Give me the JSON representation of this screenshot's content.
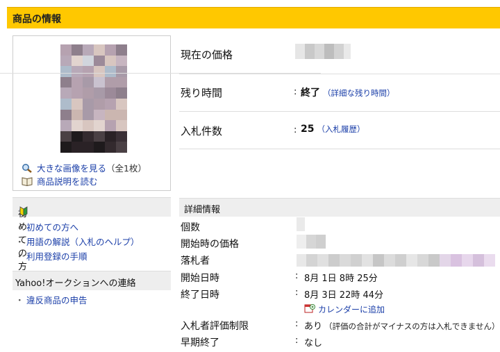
{
  "title": "商品の情報",
  "image_links": {
    "enlarge": "大きな画像を見る",
    "count": "（全1枚）",
    "description": "商品説明を読む"
  },
  "price_rows": {
    "current_price_label": "現在の価格",
    "time_left_label": "残り時間",
    "time_left_value": "終了",
    "time_left_link": "（詳細な残り時間）",
    "bids_label": "入札件数",
    "bids_value": "25",
    "bids_link": "（入札履歴）"
  },
  "sidebar": {
    "beginner_heading": "初めての方",
    "beginner_items": [
      "初めての方へ",
      "用語の解説（入札のヘルプ）",
      "利用登録の手順"
    ],
    "contact_heading": "Yahoo!オークションへの連絡",
    "contact_items": [
      "違反商品の申告"
    ]
  },
  "details": {
    "heading": "詳細情報",
    "quantity_label": "個数",
    "start_price_label": "開始時の価格",
    "winner_label": "落札者",
    "start_date_label": "開始日時",
    "start_date_value": "8月 1日 8時 25分",
    "end_date_label": "終了日時",
    "end_date_value": "8月 3日 22時 44分",
    "calendar_link": "カレンダーに追加",
    "rating_limit_label": "入札者評価制限",
    "rating_limit_value": "あり",
    "rating_limit_note": "（評価の合計がマイナスの方は入札できません）",
    "early_end_label": "早期終了",
    "early_end_value": "なし"
  },
  "colors": {
    "title_bar": "#ffc800",
    "link": "#1a3ea8",
    "section_bg": "#eeeeee"
  }
}
